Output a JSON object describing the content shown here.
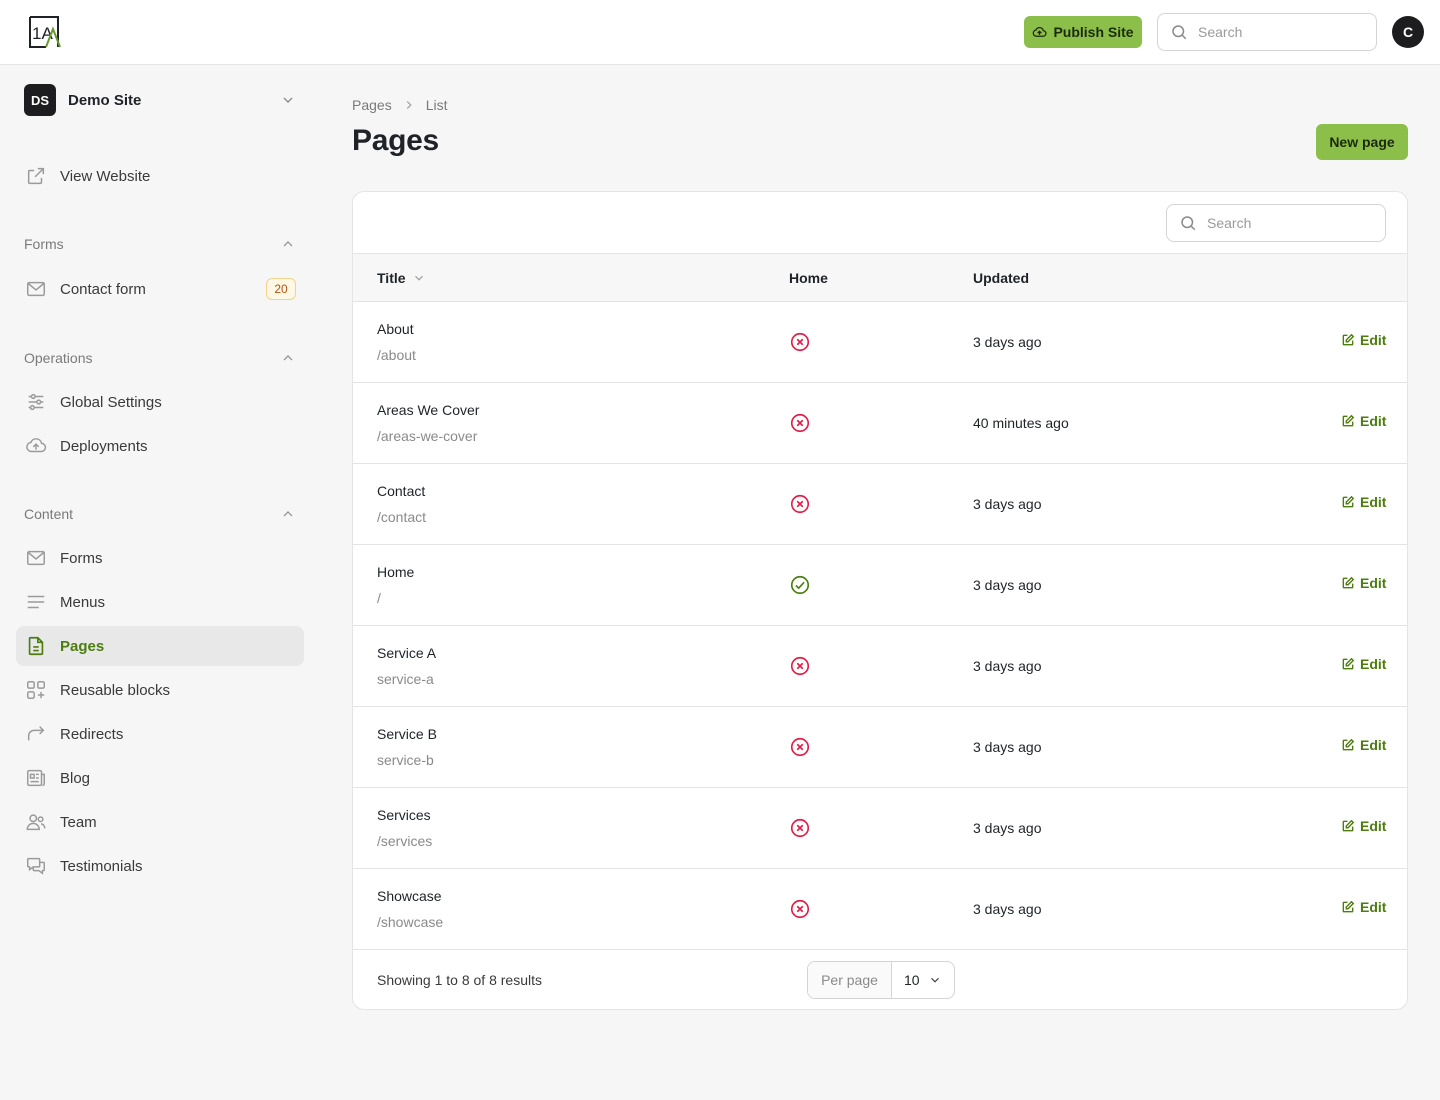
{
  "topbar": {
    "logo_text": "1A",
    "publish_label": "Publish Site",
    "search_placeholder": "Search",
    "avatar_initial": "C"
  },
  "sidebar": {
    "site_badge": "DS",
    "site_name": "Demo Site",
    "view_website": "View Website",
    "groups": {
      "forms": "Forms",
      "operations": "Operations",
      "content": "Content"
    },
    "items": {
      "contact_form": "Contact form",
      "contact_form_count": "20",
      "global_settings": "Global Settings",
      "deployments": "Deployments",
      "forms": "Forms",
      "menus": "Menus",
      "pages": "Pages",
      "reusable_blocks": "Reusable blocks",
      "redirects": "Redirects",
      "blog": "Blog",
      "team": "Team",
      "testimonials": "Testimonials"
    }
  },
  "breadcrumb": [
    "Pages",
    "List"
  ],
  "page_title": "Pages",
  "new_page_label": "New page",
  "table": {
    "search_placeholder": "Search",
    "columns": {
      "title": "Title",
      "home": "Home",
      "updated": "Updated"
    },
    "edit_label": "Edit",
    "rows": [
      {
        "title": "About",
        "slug": "/about",
        "home": false,
        "updated": "3 days ago"
      },
      {
        "title": "Areas We Cover",
        "slug": "/areas-we-cover",
        "home": false,
        "updated": "40 minutes ago"
      },
      {
        "title": "Contact",
        "slug": "/contact",
        "home": false,
        "updated": "3 days ago"
      },
      {
        "title": "Home",
        "slug": "/",
        "home": true,
        "updated": "3 days ago"
      },
      {
        "title": "Service A",
        "slug": "service-a",
        "home": false,
        "updated": "3 days ago"
      },
      {
        "title": "Service B",
        "slug": "service-b",
        "home": false,
        "updated": "3 days ago"
      },
      {
        "title": "Services",
        "slug": "/services",
        "home": false,
        "updated": "3 days ago"
      },
      {
        "title": "Showcase",
        "slug": "/showcase",
        "home": false,
        "updated": "3 days ago"
      }
    ],
    "footer_text": "Showing 1 to 8 of 8 results",
    "per_page_label": "Per page",
    "per_page_value": "10"
  },
  "colors": {
    "accent": "#8bbf4a",
    "accent_text": "#4d7c0f",
    "danger": "#e11d48",
    "success": "#4d7c0f"
  }
}
